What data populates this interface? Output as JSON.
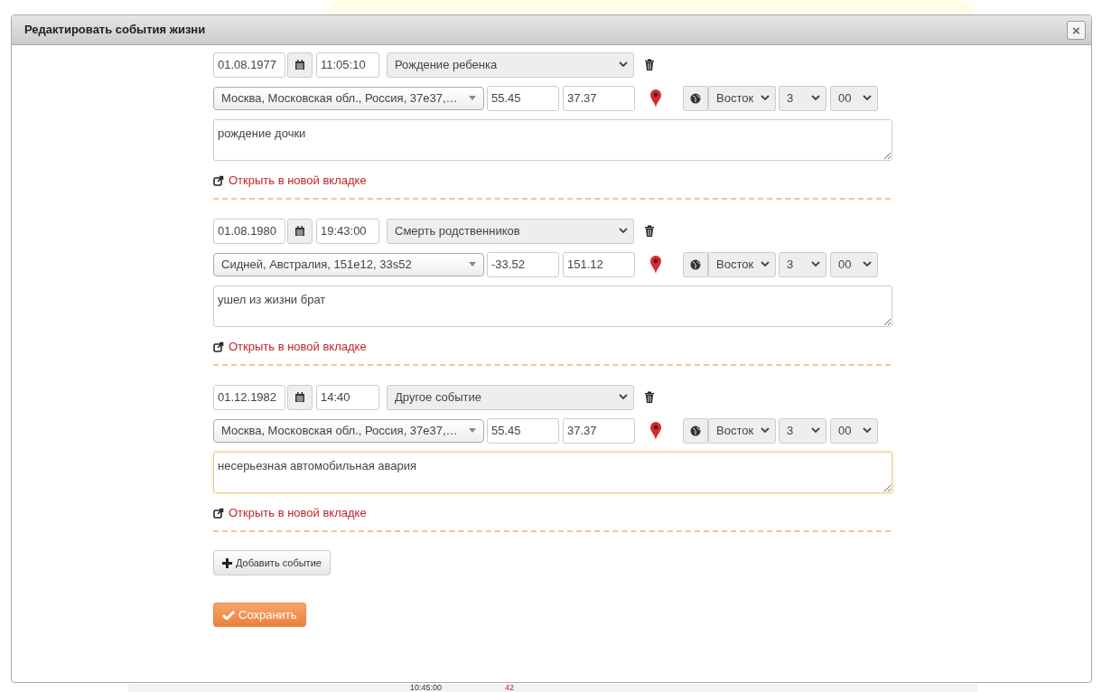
{
  "dialog": {
    "title": "Редактировать события жизни",
    "close_label": "×"
  },
  "events": [
    {
      "date": "01.08.1977",
      "time": "11:05:10",
      "type": "Рождение ребенка",
      "place": "Москва, Московская обл., Россия, 37e37,…",
      "lat": "55.45",
      "lon": "37.37",
      "tz_direction": "Восток",
      "tz_hours": "3",
      "tz_minutes": "00",
      "note": "рождение дочки",
      "focused": false,
      "link": "Открыть в новой вкладке"
    },
    {
      "date": "01.08.1980",
      "time": "19:43:00",
      "type": "Смерть родственников",
      "place": "Сидней, Австралия, 151e12, 33s52",
      "lat": "-33.52",
      "lon": "151.12",
      "tz_direction": "Восток",
      "tz_hours": "3",
      "tz_minutes": "00",
      "note": "ушел из жизни брат",
      "focused": false,
      "link": "Открыть в новой вкладке"
    },
    {
      "date": "01.12.1982",
      "time": "14:40",
      "type": "Другое событие",
      "place": "Москва, Московская обл., Россия, 37e37,…",
      "lat": "55.45",
      "lon": "37.37",
      "tz_direction": "Восток",
      "tz_hours": "3",
      "tz_minutes": "00",
      "note": "несерьезная автомобильная авария",
      "focused": true,
      "link": "Открыть в новой вкладке"
    }
  ],
  "add_button": "Добавить событие",
  "save_button": "Сохранить",
  "background_row": {
    "time": "10:45:00",
    "count": "42"
  }
}
